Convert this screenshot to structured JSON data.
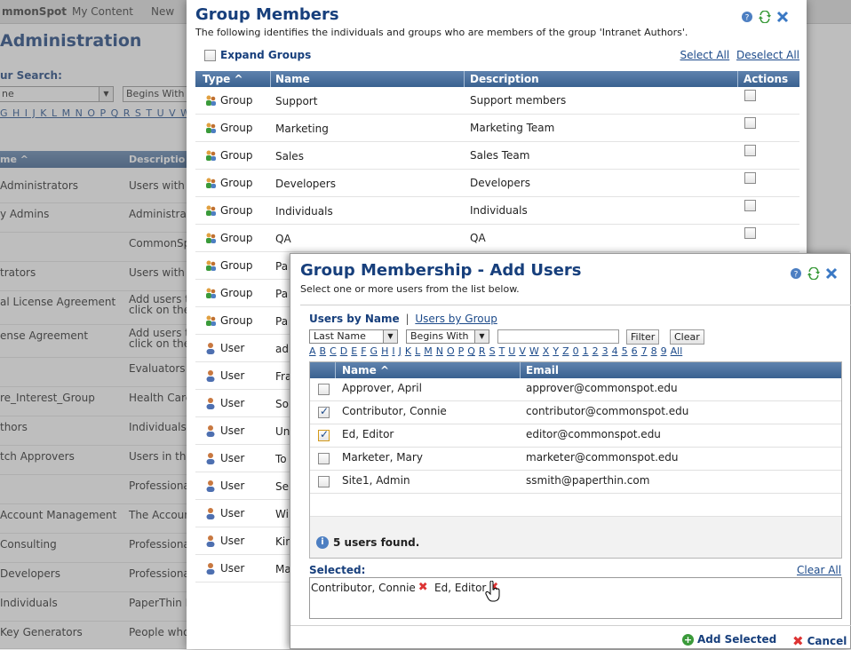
{
  "colors": {
    "header_blue": "#3a6190",
    "title_blue": "#173f7c",
    "link_blue": "#1c4a8a",
    "remove_red": "#dd3333",
    "add_green": "#3a9a3a"
  },
  "background": {
    "nav": [
      "mmonSpot",
      "My Content",
      "New"
    ],
    "title": "Administration",
    "search_label": "ur Search:",
    "search_field": "ne",
    "search_mode": "Begins With",
    "letters": "G H I J K L M N O P Q R S T U V W X",
    "col_name": "me ^",
    "col_desc": "Descriptio",
    "rows": [
      {
        "name": " Administrators",
        "desc": "Users with"
      },
      {
        "name": "y Admins",
        "desc": "Administrat"
      },
      {
        "name": "",
        "desc": "CommonSp"
      },
      {
        "name": "trators",
        "desc": "Users with"
      },
      {
        "name": "al License Agreement",
        "desc": "Add users t",
        "desc2": "click on the"
      },
      {
        "name": "ense Agreement",
        "desc": "Add users t",
        "desc2": "click on the"
      },
      {
        "name": "",
        "desc": "Evaluators"
      },
      {
        "name": "re_Interest_Group",
        "desc": "Health Care"
      },
      {
        "name": "thors",
        "desc": "Individuals"
      },
      {
        "name": "tch Approvers",
        "desc": "Users in thi"
      },
      {
        "name": "",
        "desc": "Professiona"
      },
      {
        "name": "Account Management",
        "desc": "The Accoun"
      },
      {
        "name": "Consulting",
        "desc": "Professiona"
      },
      {
        "name": "Developers",
        "desc": "Professiona"
      },
      {
        "name": "Individuals",
        "desc": "PaperThin I"
      },
      {
        "name": "Key Generators",
        "desc": "People who"
      }
    ]
  },
  "group_members": {
    "title": "Group Members",
    "description": "The following identifies the individuals and groups who are members of the group 'Intranet Authors'.",
    "expand_groups": "Expand Groups",
    "select_all": "Select All",
    "deselect_all": "Deselect All",
    "columns": {
      "type": "Type ^",
      "name": "Name",
      "description": "Description",
      "actions": "Actions"
    },
    "rows": [
      {
        "type": "Group",
        "name": "Support",
        "desc": "Support members"
      },
      {
        "type": "Group",
        "name": "Marketing",
        "desc": "Marketing Team"
      },
      {
        "type": "Group",
        "name": "Sales",
        "desc": "Sales Team"
      },
      {
        "type": "Group",
        "name": "Developers",
        "desc": "Developers"
      },
      {
        "type": "Group",
        "name": "Individuals",
        "desc": "Individuals"
      },
      {
        "type": "Group",
        "name": "QA",
        "desc": "QA"
      },
      {
        "type": "Group",
        "name": "Pa",
        "desc": ""
      },
      {
        "type": "Group",
        "name": "Pa",
        "desc": ""
      },
      {
        "type": "Group",
        "name": "Pa",
        "desc": ""
      },
      {
        "type": "User",
        "name": "ad",
        "desc": ""
      },
      {
        "type": "User",
        "name": "Fra",
        "desc": ""
      },
      {
        "type": "User",
        "name": "So",
        "desc": ""
      },
      {
        "type": "User",
        "name": "Un",
        "desc": ""
      },
      {
        "type": "User",
        "name": "To",
        "desc": ""
      },
      {
        "type": "User",
        "name": "Se",
        "desc": ""
      },
      {
        "type": "User",
        "name": "Wi",
        "desc": ""
      },
      {
        "type": "User",
        "name": "Kin",
        "desc": ""
      },
      {
        "type": "User",
        "name": "Ma",
        "desc": ""
      }
    ]
  },
  "add_users": {
    "title": "Group Membership - Add Users",
    "subtitle": "Select one or more users from the list below.",
    "tab_active": "Users by Name",
    "tab_separator": "|",
    "tab_other": "Users by Group",
    "field_select": "Last Name",
    "mode_select": "Begins With",
    "filter_value": "",
    "filter_btn": "Filter",
    "clear_btn": "Clear",
    "letters": [
      "A",
      "B",
      "C",
      "D",
      "E",
      "F",
      "G",
      "H",
      "I",
      "J",
      "K",
      "L",
      "M",
      "N",
      "O",
      "P",
      "Q",
      "R",
      "S",
      "T",
      "U",
      "V",
      "W",
      "X",
      "Y",
      "Z",
      "0",
      "1",
      "2",
      "3",
      "4",
      "5",
      "6",
      "7",
      "8",
      "9",
      "All"
    ],
    "col_name": "Name ^",
    "col_email": "Email",
    "users": [
      {
        "name": "Approver, April",
        "email": "approver@commonspot.edu",
        "checked": false,
        "focus": false
      },
      {
        "name": "Contributor, Connie",
        "email": "contributor@commonspot.edu",
        "checked": true,
        "focus": false
      },
      {
        "name": "Ed, Editor",
        "email": "editor@commonspot.edu",
        "checked": true,
        "focus": true
      },
      {
        "name": "Marketer, Mary",
        "email": "marketer@commonspot.edu",
        "checked": false,
        "focus": false
      },
      {
        "name": "Site1, Admin",
        "email": "ssmith@paperthin.com",
        "checked": false,
        "focus": false
      }
    ],
    "found_text": "5 users found.",
    "selected_label": "Selected:",
    "clear_all": "Clear All",
    "selected": [
      "Contributor, Connie",
      "Ed, Editor"
    ],
    "add_selected": "Add Selected",
    "cancel": "Cancel"
  }
}
